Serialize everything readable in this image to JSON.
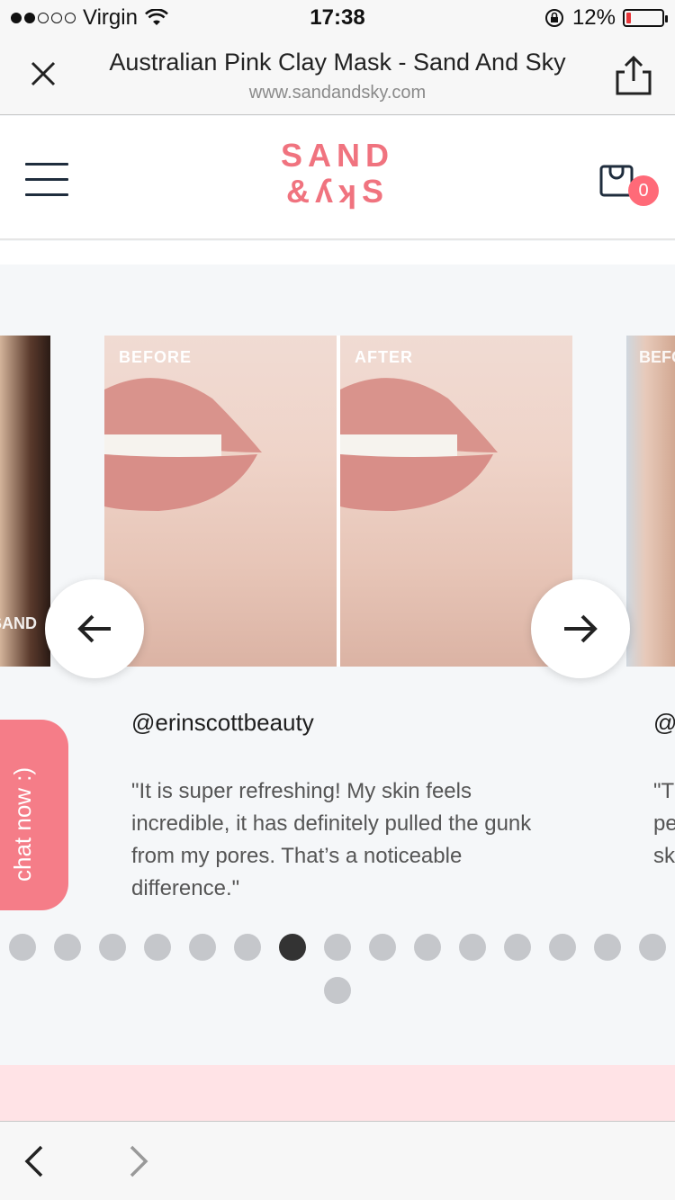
{
  "status_bar": {
    "carrier": "Virgin",
    "time": "17:38",
    "battery_percent": "12%",
    "battery_level": 0.12,
    "signal_bars_filled": 2,
    "signal_bars_total": 5
  },
  "browser": {
    "title": "Australian Pink Clay Mask - Sand And Sky",
    "url": "www.sandandsky.com"
  },
  "site_header": {
    "logo_line1": "SAND",
    "logo_line2": "&ʎʞS",
    "cart_count": "0"
  },
  "carousel": {
    "before_label": "BEFORE",
    "after_label": "AFTER",
    "left_partial_brand": "SAND",
    "right_partial_label": "BEFO",
    "active_slide": {
      "handle": "@erinscottbeauty",
      "quote": "\"It is super refreshing! My skin feels incredible, it has definitely pulled the gunk from my pores. That’s a noticeable difference.\""
    },
    "next_slide_partial": {
      "handle": "@",
      "quote": "\"T\npe\nsk"
    },
    "dot_count": 16,
    "active_dot_index": 6
  },
  "chat": {
    "label": "chat now :)"
  },
  "colors": {
    "brand_pink": "#f0737f",
    "chat_pink": "#f57d88",
    "badge_pink": "#ff6a78",
    "active_dot": "#333333",
    "inactive_dot": "#c5c7cb"
  }
}
